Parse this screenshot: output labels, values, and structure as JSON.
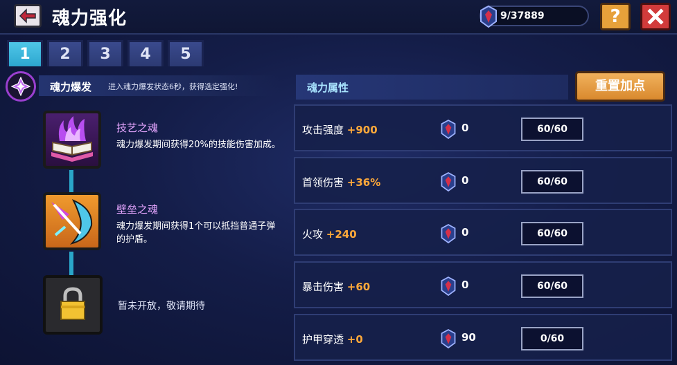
{
  "header": {
    "title": "魂力强化",
    "currency_text": "9/37889",
    "help_label": "?"
  },
  "tabs": [
    {
      "label": "1",
      "active": true
    },
    {
      "label": "2",
      "active": false
    },
    {
      "label": "3",
      "active": false
    },
    {
      "label": "4",
      "active": false
    },
    {
      "label": "5",
      "active": false
    }
  ],
  "burst": {
    "name": "魂力爆发",
    "description": "进入魂力爆发状态6秒，获得选定强化!"
  },
  "skills": [
    {
      "name": "技艺之魂",
      "description": "魂力爆发期间获得20%的技能伤害加成。",
      "icon": "purple-flame-book-icon"
    },
    {
      "name": "壁垒之魂",
      "description": "魂力爆发期间获得1个可以抵挡普通子弹的护盾。",
      "icon": "shield-bow-icon"
    },
    {
      "name": "",
      "description": "暂未开放，敬请期待",
      "icon": "lock-icon"
    }
  ],
  "attributes": {
    "header": "魂力属性",
    "reset_label": "重置加点",
    "rows": [
      {
        "name": "攻击强度",
        "bonus": "+900",
        "cost": "0",
        "level": "60/60"
      },
      {
        "name": "首领伤害",
        "bonus": "+36%",
        "cost": "0",
        "level": "60/60"
      },
      {
        "name": "火攻",
        "bonus": "+240",
        "cost": "0",
        "level": "60/60"
      },
      {
        "name": "暴击伤害",
        "bonus": "+60",
        "cost": "0",
        "level": "60/60"
      },
      {
        "name": "护甲穿透",
        "bonus": "+0",
        "cost": "90",
        "level": "0/60"
      }
    ]
  },
  "colors": {
    "accent_orange": "#ffa93a",
    "tab_active": "#4fc7e8",
    "skill_name": "#e6a6ff"
  }
}
